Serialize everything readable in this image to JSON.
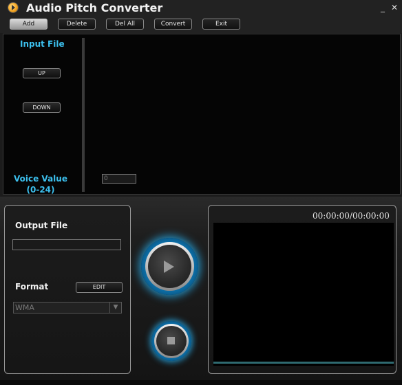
{
  "window": {
    "title": "Audio Pitch Converter",
    "minimize": "_",
    "close": "✕"
  },
  "toolbar": {
    "buttons": [
      {
        "label": "Add",
        "active": true
      },
      {
        "label": "Delete"
      },
      {
        "label": "Del All"
      },
      {
        "label": "Convert"
      },
      {
        "label": "Exit"
      }
    ]
  },
  "input_panel": {
    "title": "Input File",
    "up_label": "UP",
    "down_label": "DOWN",
    "voice_value_label": "Voice Value",
    "voice_value_range": "(0-24)",
    "voice_value": "0"
  },
  "output_panel": {
    "title": "Output File",
    "output_path": "",
    "format_label": "Format",
    "edit_label": "EDIT",
    "format_value": "WMA"
  },
  "player": {
    "time": "00:00:00/00:00:00",
    "progress": 0
  },
  "colors": {
    "accent": "#3cc0ee",
    "glow": "#1fa8e0",
    "panel": "#050505"
  },
  "icons": {
    "app": "audio-app-icon",
    "play": "play-icon",
    "stop": "stop-icon",
    "dropdown": "chevron-down-icon"
  }
}
